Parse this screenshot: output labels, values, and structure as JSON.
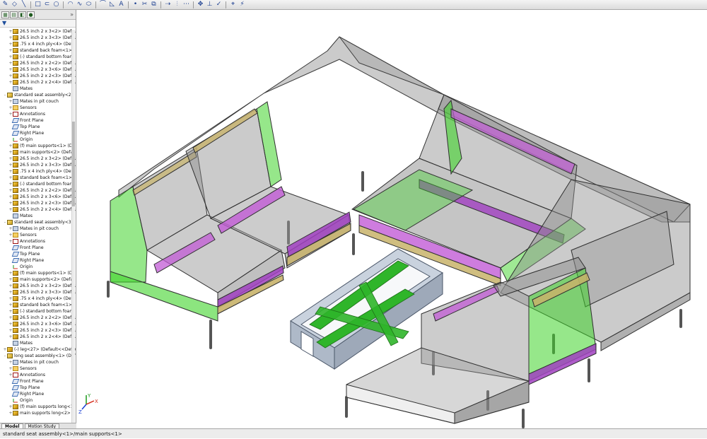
{
  "toolbar": {
    "icons": [
      "sketch-icon",
      "smart-dimension-icon",
      "line-icon",
      "rectangle-icon",
      "slot-icon",
      "circle-icon",
      "arc-icon",
      "spline-icon",
      "ellipse-icon",
      "fillet-icon",
      "chamfer-icon",
      "text-icon",
      "point-icon",
      "trim-icon",
      "offset-icon",
      "convert-icon",
      "mirror-icon",
      "linear-pattern-icon",
      "move-icon",
      "relations-icon",
      "repair-icon",
      "quick-snaps-icon",
      "rapid-sketch-icon"
    ]
  },
  "feature_manager": {
    "tabs": [
      "feature-tree-tab",
      "property-manager-tab",
      "configuration-tab",
      "display-manager-tab"
    ],
    "expand_glyph": "»",
    "filter_glyph": "▼",
    "tree": [
      {
        "indent": 2,
        "toggle": "+",
        "icon": "part",
        "label": "26.5 inch 2 x 3<2> (Defau"
      },
      {
        "indent": 2,
        "toggle": "+",
        "icon": "part",
        "label": "26.5 inch 2 x 3<3> (Defau"
      },
      {
        "indent": 2,
        "toggle": "+",
        "icon": "part",
        "label": ".75 x 4 inch ply<4> (Defa"
      },
      {
        "indent": 2,
        "toggle": "+",
        "icon": "part",
        "label": "standard back foam<1>"
      },
      {
        "indent": 2,
        "toggle": "+",
        "icon": "part",
        "label": "(-) standard bottom foam"
      },
      {
        "indent": 2,
        "toggle": "+",
        "icon": "part",
        "label": "26.5 inch 2 x 2<2> (Defau"
      },
      {
        "indent": 2,
        "toggle": "+",
        "icon": "part",
        "label": "26.5 inch 2 x 3<6> (Defau"
      },
      {
        "indent": 2,
        "toggle": "+",
        "icon": "part",
        "label": "26.5 inch 2 x 2<3> (Defau"
      },
      {
        "indent": 2,
        "toggle": "+",
        "icon": "part",
        "label": "26.5 inch 2 x 2<4> (Defau"
      },
      {
        "indent": 2,
        "toggle": "",
        "icon": "mates",
        "label": "Mates"
      },
      {
        "indent": 1,
        "toggle": "-",
        "icon": "asm",
        "label": "standard seat assembly<2> ("
      },
      {
        "indent": 2,
        "toggle": "+",
        "icon": "mates",
        "label": "Mates in pit couch"
      },
      {
        "indent": 2,
        "toggle": "+",
        "icon": "folder",
        "label": "Sensors"
      },
      {
        "indent": 2,
        "toggle": "+",
        "icon": "ann",
        "label": "Annotations"
      },
      {
        "indent": 2,
        "toggle": "",
        "icon": "plane",
        "label": "Front Plane"
      },
      {
        "indent": 2,
        "toggle": "",
        "icon": "plane",
        "label": "Top Plane"
      },
      {
        "indent": 2,
        "toggle": "",
        "icon": "plane",
        "label": "Right Plane"
      },
      {
        "indent": 2,
        "toggle": "",
        "icon": "origin",
        "label": "Origin"
      },
      {
        "indent": 2,
        "toggle": "+",
        "icon": "part",
        "label": "(f) main supports<1> (De"
      },
      {
        "indent": 2,
        "toggle": "+",
        "icon": "part",
        "label": "main supports<2> (Defa"
      },
      {
        "indent": 2,
        "toggle": "+",
        "icon": "part",
        "label": "26.5 inch 2 x 3<2> (Defau"
      },
      {
        "indent": 2,
        "toggle": "+",
        "icon": "part",
        "label": "26.5 inch 2 x 3<3> (Defau"
      },
      {
        "indent": 2,
        "toggle": "+",
        "icon": "part",
        "label": ".75 x 4 inch ply<4> (Defa"
      },
      {
        "indent": 2,
        "toggle": "+",
        "icon": "part",
        "label": "standard back foam<1>"
      },
      {
        "indent": 2,
        "toggle": "+",
        "icon": "part",
        "label": "(-) standard bottom foam"
      },
      {
        "indent": 2,
        "toggle": "+",
        "icon": "part",
        "label": "26.5 inch 2 x 2<2> (Defau"
      },
      {
        "indent": 2,
        "toggle": "+",
        "icon": "part",
        "label": "26.5 inch 2 x 3<6> (Defau"
      },
      {
        "indent": 2,
        "toggle": "+",
        "icon": "part",
        "label": "26.5 inch 2 x 2<3> (Defau"
      },
      {
        "indent": 2,
        "toggle": "+",
        "icon": "part",
        "label": "26.5 inch 2 x 2<4> (Defau"
      },
      {
        "indent": 2,
        "toggle": "",
        "icon": "mates",
        "label": "Mates"
      },
      {
        "indent": 1,
        "toggle": "-",
        "icon": "asm",
        "label": "standard seat assembly<3> ("
      },
      {
        "indent": 2,
        "toggle": "+",
        "icon": "mates",
        "label": "Mates in pit couch"
      },
      {
        "indent": 2,
        "toggle": "+",
        "icon": "folder",
        "label": "Sensors"
      },
      {
        "indent": 2,
        "toggle": "+",
        "icon": "ann",
        "label": "Annotations"
      },
      {
        "indent": 2,
        "toggle": "",
        "icon": "plane",
        "label": "Front Plane"
      },
      {
        "indent": 2,
        "toggle": "",
        "icon": "plane",
        "label": "Top Plane"
      },
      {
        "indent": 2,
        "toggle": "",
        "icon": "plane",
        "label": "Right Plane"
      },
      {
        "indent": 2,
        "toggle": "",
        "icon": "origin",
        "label": "Origin"
      },
      {
        "indent": 2,
        "toggle": "+",
        "icon": "part",
        "label": "(f) main supports<1> (De"
      },
      {
        "indent": 2,
        "toggle": "+",
        "icon": "part",
        "label": "main supports<2> (Defa"
      },
      {
        "indent": 2,
        "toggle": "+",
        "icon": "part",
        "label": "26.5 inch 2 x 3<2> (Defau"
      },
      {
        "indent": 2,
        "toggle": "+",
        "icon": "part",
        "label": "26.5 inch 2 x 3<3> (Defau"
      },
      {
        "indent": 2,
        "toggle": "+",
        "icon": "part",
        "label": ".75 x 4 inch ply<4> (Defa"
      },
      {
        "indent": 2,
        "toggle": "+",
        "icon": "part",
        "label": "standard back foam<1>"
      },
      {
        "indent": 2,
        "toggle": "+",
        "icon": "part",
        "label": "(-) standard bottom foam"
      },
      {
        "indent": 2,
        "toggle": "+",
        "icon": "part",
        "label": "26.5 inch 2 x 2<2> (Defau"
      },
      {
        "indent": 2,
        "toggle": "+",
        "icon": "part",
        "label": "26.5 inch 2 x 3<6> (Defau"
      },
      {
        "indent": 2,
        "toggle": "+",
        "icon": "part",
        "label": "26.5 inch 2 x 2<3> (Defau"
      },
      {
        "indent": 2,
        "toggle": "+",
        "icon": "part",
        "label": "26.5 inch 2 x 2<4> (Defau"
      },
      {
        "indent": 2,
        "toggle": "",
        "icon": "mates",
        "label": "Mates"
      },
      {
        "indent": 1,
        "toggle": "+",
        "icon": "part",
        "label": "(-) leg<27> (Default<<Defau"
      },
      {
        "indent": 1,
        "toggle": "-",
        "icon": "asm",
        "label": "long seat assembly<1> (Defa"
      },
      {
        "indent": 2,
        "toggle": "+",
        "icon": "mates",
        "label": "Mates in pit couch"
      },
      {
        "indent": 2,
        "toggle": "+",
        "icon": "folder",
        "label": "Sensors"
      },
      {
        "indent": 2,
        "toggle": "+",
        "icon": "ann",
        "label": "Annotations"
      },
      {
        "indent": 2,
        "toggle": "",
        "icon": "plane",
        "label": "Front Plane"
      },
      {
        "indent": 2,
        "toggle": "",
        "icon": "plane",
        "label": "Top Plane"
      },
      {
        "indent": 2,
        "toggle": "",
        "icon": "plane",
        "label": "Right Plane"
      },
      {
        "indent": 2,
        "toggle": "",
        "icon": "origin",
        "label": "Origin"
      },
      {
        "indent": 2,
        "toggle": "+",
        "icon": "part",
        "label": "(f) main supports long<1"
      },
      {
        "indent": 2,
        "toggle": "+",
        "icon": "part",
        "label": "main supports long<2> ("
      }
    ]
  },
  "bottom_tabs": [
    {
      "label": "Model",
      "active": true
    },
    {
      "label": "Motion Study",
      "active": false
    }
  ],
  "viewport": {
    "axes": {
      "x": "X",
      "y": "Y",
      "z": "Z"
    },
    "colors": {
      "frame_gray": "#8b8b8b",
      "frame_edge": "#3a3a3a",
      "support_green": "#3fd32a",
      "foam_pink": "#c25bd6",
      "wood_yellow": "#c8b36a",
      "table_steel": "#c9d2de"
    }
  },
  "statusbar": {
    "path": "standard seat assembly<1>/main supports<1>"
  }
}
